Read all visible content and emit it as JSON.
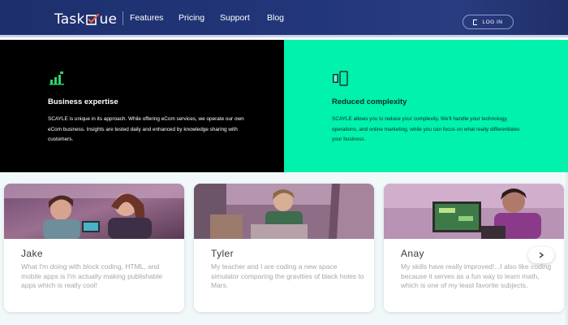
{
  "header": {
    "logo_prefix": "Task",
    "logo_suffix": "ue",
    "nav": [
      "Features",
      "Pricing",
      "Support",
      "Blog"
    ],
    "login_label": "LOG IN"
  },
  "features": [
    {
      "title": "Business expertise",
      "text": "SCAYLE is unique in its approach. While offering eCom services, we operate our own eCom business. Insights are tested daily and enhanced by knowledge sharing with customers.",
      "icon": "bar-chart-icon"
    },
    {
      "title": "Reduced complexity",
      "text": "SCAYLE allows you to reduce your complexity. We'll handle your technology, operations, and online marketing, while you can focus on what really differentiates your business.",
      "icon": "devices-icon"
    }
  ],
  "testimonials": [
    {
      "name": "Jake",
      "quote": "What I'm doing with block coding, HTML, and mobile apps is I'm actually making publishable apps which is really cool!"
    },
    {
      "name": "Tyler",
      "quote": "My teacher and I are coding a new space simulator comparing the gravities of black holes to Mars."
    },
    {
      "name": "Anay",
      "quote": "My skills have really improved!...I also like coding because it serves as a fun way to learn math, which is one of my least favorite subjects."
    }
  ],
  "colors": {
    "header_bg": "#1d2f6c",
    "accent_orange": "#f0603a",
    "mint": "#00f2ac",
    "icon_green": "#2ed06a"
  }
}
